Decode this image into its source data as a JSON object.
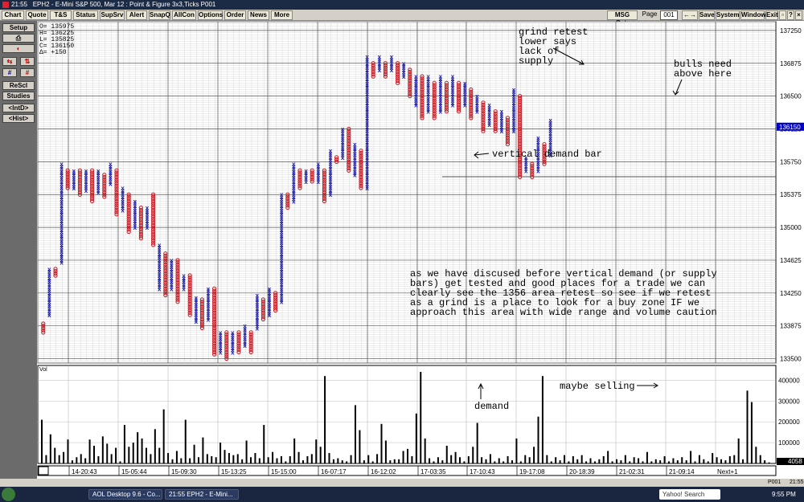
{
  "window": {
    "time": "21:55",
    "title": "EPH2 - E-Mini S&P 500, Mar 12 : Point & Figure 3x3,Ticks  P001"
  },
  "menu": {
    "items": [
      "Chart",
      "Quote",
      "T&S",
      "Status",
      "SupSrv",
      "Alert",
      "SnapQ",
      "AllCon",
      "Options",
      "Order",
      "News",
      "More"
    ],
    "right": {
      "msg": "MSG Cntr",
      "page_label": "Page",
      "page_value": "001",
      "arrows": "←→",
      "save": "Save",
      "system": "System",
      "window": "Window",
      "exit": "Exit"
    }
  },
  "left_panel": {
    "setup": "Setup",
    "rescl": "ReScl",
    "studies": "Studies",
    "intd": "<IntD>",
    "hist": "<Hist>"
  },
  "ohlc": [
    "O= 135975",
    "H= 136225",
    "L= 135825",
    "C= 136150",
    "Δ=   +150"
  ],
  "price_axis": {
    "labels": [
      "137250",
      "136875",
      "136500",
      "136125",
      "135750",
      "135375",
      "135000",
      "134625",
      "134250",
      "133875",
      "133500"
    ],
    "current": "136150"
  },
  "volume_axis": {
    "labels": [
      "400000",
      "300000",
      "200000",
      "100000"
    ],
    "current": "4058",
    "label": "Vol"
  },
  "time_axis": [
    "14-20:43",
    "15-05:44",
    "15-09:30",
    "15-13:25",
    "15-15:00",
    "16-07:17",
    "16-12:02",
    "17-03:35",
    "17-10:43",
    "19-17:08",
    "20-18:39",
    "21-02:31",
    "21-09:14"
  ],
  "next_label": "Next+1",
  "annotations": {
    "grind": [
      "grind retest",
      "lower says",
      "lack of",
      "supply"
    ],
    "bulls": [
      "bulls need",
      "above here"
    ],
    "vertical": "vertical demand bar",
    "discussion": [
      "as we have discused before vertical demand  (or supply",
      "bars) get tested and good places for a trade we can",
      "clearly see the 1356 area retest so see if we retest",
      "as a grind is a place to look for a buy  zone IF we",
      "approach this area with wide range and volume caution"
    ],
    "demand": "demand",
    "maybe": "maybe selling"
  },
  "status": {
    "page": "P001",
    "time": "21:55"
  },
  "taskbar": {
    "items": [
      "AOL Desktop 9.6 - Co...",
      "21:55  EPH2 - E-Mini..."
    ],
    "search": "Yahoo! Search",
    "clock": "9:55 PM"
  },
  "chart_data": {
    "type": "point-and-figure",
    "symbol": "EPH2",
    "box_ticks": 3,
    "reversal": 3,
    "y_range": [
      133450,
      137350
    ],
    "current_price": 136150,
    "columns": [
      {
        "t": "o",
        "hi": 133900,
        "lo": 133800
      },
      {
        "t": "x",
        "hi": 134525,
        "lo": 134000
      },
      {
        "t": "o",
        "hi": 134525,
        "lo": 134450
      },
      {
        "t": "x",
        "hi": 135725,
        "lo": 134600
      },
      {
        "t": "o",
        "hi": 135650,
        "lo": 135450
      },
      {
        "t": "x",
        "hi": 135650,
        "lo": 135450
      },
      {
        "t": "o",
        "hi": 135650,
        "lo": 135375
      },
      {
        "t": "x",
        "hi": 135650,
        "lo": 135425
      },
      {
        "t": "o",
        "hi": 135650,
        "lo": 135300
      },
      {
        "t": "x",
        "hi": 135650,
        "lo": 135400
      },
      {
        "t": "o",
        "hi": 135600,
        "lo": 135350
      },
      {
        "t": "x",
        "hi": 135725,
        "lo": 135500
      },
      {
        "t": "o",
        "hi": 135650,
        "lo": 135150
      },
      {
        "t": "x",
        "hi": 135450,
        "lo": 135200
      },
      {
        "t": "o",
        "hi": 135375,
        "lo": 134950
      },
      {
        "t": "x",
        "hi": 135300,
        "lo": 135000
      },
      {
        "t": "o",
        "hi": 135225,
        "lo": 134875
      },
      {
        "t": "x",
        "hi": 135225,
        "lo": 135000
      },
      {
        "t": "o",
        "hi": 135375,
        "lo": 134800
      },
      {
        "t": "x",
        "hi": 134800,
        "lo": 134300
      },
      {
        "t": "o",
        "hi": 134700,
        "lo": 134225
      },
      {
        "t": "x",
        "hi": 134625,
        "lo": 134300
      },
      {
        "t": "o",
        "hi": 134625,
        "lo": 134150
      },
      {
        "t": "x",
        "hi": 134450,
        "lo": 134300
      },
      {
        "t": "o",
        "hi": 134450,
        "lo": 134000
      },
      {
        "t": "x",
        "hi": 134200,
        "lo": 133925
      },
      {
        "t": "o",
        "hi": 134175,
        "lo": 133850
      },
      {
        "t": "x",
        "hi": 134300,
        "lo": 133950
      },
      {
        "t": "o",
        "hi": 134300,
        "lo": 133550
      },
      {
        "t": "x",
        "hi": 133800,
        "lo": 133575
      },
      {
        "t": "o",
        "hi": 133800,
        "lo": 133500
      },
      {
        "t": "x",
        "hi": 133800,
        "lo": 133575
      },
      {
        "t": "o",
        "hi": 133800,
        "lo": 133575
      },
      {
        "t": "x",
        "hi": 133875,
        "lo": 133650
      },
      {
        "t": "o",
        "hi": 133800,
        "lo": 133575
      },
      {
        "t": "x",
        "hi": 134225,
        "lo": 133850
      },
      {
        "t": "o",
        "hi": 134175,
        "lo": 133950
      },
      {
        "t": "x",
        "hi": 134300,
        "lo": 134000
      },
      {
        "t": "o",
        "hi": 134250,
        "lo": 134050
      },
      {
        "t": "x",
        "hi": 135375,
        "lo": 134150
      },
      {
        "t": "o",
        "hi": 135375,
        "lo": 135225
      },
      {
        "t": "x",
        "hi": 135725,
        "lo": 135300
      },
      {
        "t": "o",
        "hi": 135650,
        "lo": 135450
      },
      {
        "t": "x",
        "hi": 135650,
        "lo": 135525
      },
      {
        "t": "o",
        "hi": 135650,
        "lo": 135525
      },
      {
        "t": "x",
        "hi": 135725,
        "lo": 135525
      },
      {
        "t": "o",
        "hi": 135650,
        "lo": 135300
      },
      {
        "t": "x",
        "hi": 135875,
        "lo": 135375
      },
      {
        "t": "o",
        "hi": 135800,
        "lo": 135750
      },
      {
        "t": "x",
        "hi": 136125,
        "lo": 135800
      },
      {
        "t": "o",
        "hi": 136125,
        "lo": 135650
      },
      {
        "t": "x",
        "hi": 135950,
        "lo": 135600
      },
      {
        "t": "o",
        "hi": 135875,
        "lo": 135450
      },
      {
        "t": "x",
        "hi": 136950,
        "lo": 135450
      },
      {
        "t": "o",
        "hi": 136875,
        "lo": 136725
      },
      {
        "t": "x",
        "hi": 136950,
        "lo": 136800
      },
      {
        "t": "o",
        "hi": 136875,
        "lo": 136725
      },
      {
        "t": "x",
        "hi": 136950,
        "lo": 136800
      },
      {
        "t": "o",
        "hi": 136875,
        "lo": 136650
      },
      {
        "t": "x",
        "hi": 136875,
        "lo": 136725
      },
      {
        "t": "o",
        "hi": 136800,
        "lo": 136500
      },
      {
        "t": "x",
        "hi": 136725,
        "lo": 136400
      },
      {
        "t": "o",
        "hi": 136725,
        "lo": 136250
      },
      {
        "t": "x",
        "hi": 136725,
        "lo": 136325
      },
      {
        "t": "o",
        "hi": 136650,
        "lo": 136250
      },
      {
        "t": "x",
        "hi": 136725,
        "lo": 136325
      },
      {
        "t": "o",
        "hi": 136650,
        "lo": 136325
      },
      {
        "t": "x",
        "hi": 136725,
        "lo": 136400
      },
      {
        "t": "o",
        "hi": 136650,
        "lo": 136325
      },
      {
        "t": "x",
        "hi": 136650,
        "lo": 136400
      },
      {
        "t": "o",
        "hi": 136575,
        "lo": 136250
      },
      {
        "t": "x",
        "hi": 136500,
        "lo": 136325
      },
      {
        "t": "o",
        "hi": 136425,
        "lo": 136100
      },
      {
        "t": "x",
        "hi": 136400,
        "lo": 136175
      },
      {
        "t": "o",
        "hi": 136325,
        "lo": 136100
      },
      {
        "t": "x",
        "hi": 136325,
        "lo": 136100
      },
      {
        "t": "o",
        "hi": 136250,
        "lo": 135950
      },
      {
        "t": "x",
        "hi": 136575,
        "lo": 136100
      },
      {
        "t": "o",
        "hi": 136500,
        "lo": 135575
      },
      {
        "t": "x",
        "hi": 135800,
        "lo": 135650
      },
      {
        "t": "o",
        "hi": 135725,
        "lo": 135575
      },
      {
        "t": "x",
        "hi": 136025,
        "lo": 135650
      },
      {
        "t": "o",
        "hi": 135950,
        "lo": 135725
      },
      {
        "t": "x",
        "hi": 136225,
        "lo": 135825
      }
    ],
    "volume": [
      210000,
      40000,
      140000,
      75000,
      40000,
      55000,
      115000,
      15000,
      30000,
      45000,
      25000,
      115000,
      85000,
      35000,
      130000,
      95000,
      45000,
      75000,
      10000,
      185000,
      80000,
      100000,
      150000,
      120000,
      75000,
      45000,
      165000,
      75000,
      260000,
      50000,
      20000,
      60000,
      25000,
      210000,
      25000,
      90000,
      30000,
      125000,
      45000,
      35000,
      30000,
      100000,
      65000,
      50000,
      40000,
      45000,
      20000,
      110000,
      30000,
      50000,
      25000,
      185000,
      30000,
      55000,
      25000,
      35000,
      10000,
      35000,
      120000,
      55000,
      15000,
      35000,
      45000,
      115000,
      80000,
      420000,
      50000,
      20000,
      25000,
      15000,
      10000,
      40000,
      280000,
      160000,
      15000,
      40000,
      10000,
      45000,
      190000,
      110000,
      15000,
      20000,
      20000,
      60000,
      70000,
      35000,
      240000,
      440000,
      120000,
      25000,
      10000,
      30000,
      15000,
      85000,
      40000,
      55000,
      30000,
      10000,
      35000,
      80000,
      195000,
      30000,
      20000,
      45000,
      10000,
      25000,
      10000,
      35000,
      15000,
      120000,
      10000,
      40000,
      30000,
      80000,
      225000,
      420000,
      40000,
      10000,
      30000,
      15000,
      40000,
      10000,
      35000,
      20000,
      40000,
      10000,
      25000,
      10000,
      20000,
      35000,
      60000,
      10000,
      20000,
      15000,
      40000,
      10000,
      30000,
      25000,
      10000,
      55000,
      10000,
      20000,
      15000,
      35000,
      10000,
      25000,
      15000,
      30000,
      15000,
      60000,
      10000,
      40000,
      20000,
      10000,
      50000,
      30000,
      20000,
      15000,
      35000,
      40000,
      120000,
      20000,
      350000,
      295000,
      80000,
      40000,
      15000,
      5000
    ]
  }
}
